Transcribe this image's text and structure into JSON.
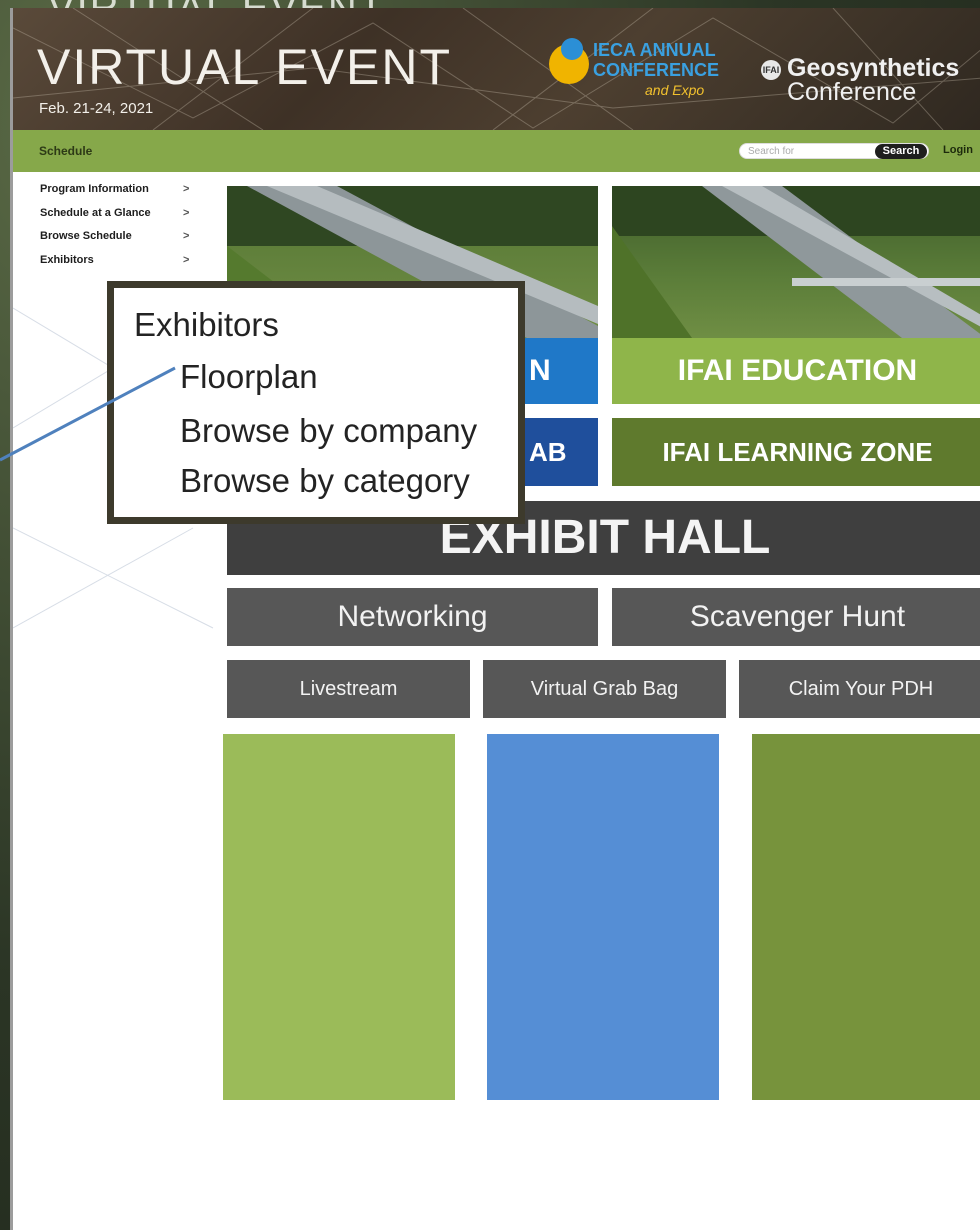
{
  "slide": {
    "ghost_title": "VIRTUAL EVENT"
  },
  "header": {
    "title": "VIRTUAL EVENT",
    "date": "Feb. 21-24, 2021",
    "ieca_logo": {
      "line1": "IECA ANNUAL",
      "line2": "CONFERENCE",
      "line3": "and Expo"
    },
    "geo_logo": {
      "badge": "IFAI",
      "line1": "Geosynthetics",
      "line2": "Conference"
    }
  },
  "nav": {
    "schedule_label": "Schedule",
    "search_placeholder": "Search for",
    "search_button": "Search",
    "login": "Login"
  },
  "left_menu": {
    "items": [
      {
        "label": "Program Information",
        "chevron": ">"
      },
      {
        "label": "Schedule at a Glance",
        "chevron": ">"
      },
      {
        "label": "Browse Schedule",
        "chevron": ">"
      },
      {
        "label": "Exhibitors",
        "chevron": ">"
      }
    ]
  },
  "tiles": {
    "left_top_partial": "N",
    "right_top": "IFAI EDUCATION",
    "left_mid_partial": "AB",
    "right_mid": "IFAI LEARNING ZONE",
    "exhibit_hall": "EXHIBIT HALL",
    "networking": "Networking",
    "scavenger_hunt": "Scavenger Hunt",
    "livestream": "Livestream",
    "virtual_grab_bag": "Virtual Grab Bag",
    "claim_pdh": "Claim Your PDH"
  },
  "blocks": {
    "colors": [
      "#9bbb59",
      "#558ed5",
      "#77933c"
    ]
  },
  "callout": {
    "title": "Exhibitors",
    "items": [
      "Floorplan",
      "Browse by company",
      "Browse by category"
    ]
  },
  "colors": {
    "nav_green": "#86a84a",
    "tile_blue": "#1f78c8",
    "tile_green": "#8fb54a",
    "tile_navy": "#1f4f9c",
    "tile_dark_green": "#5f7a2d",
    "exhibit_dark": "#3f3f3f",
    "button_gray": "#575757",
    "callout_border": "#3d3a2c",
    "connector_blue": "#4f81bd"
  }
}
